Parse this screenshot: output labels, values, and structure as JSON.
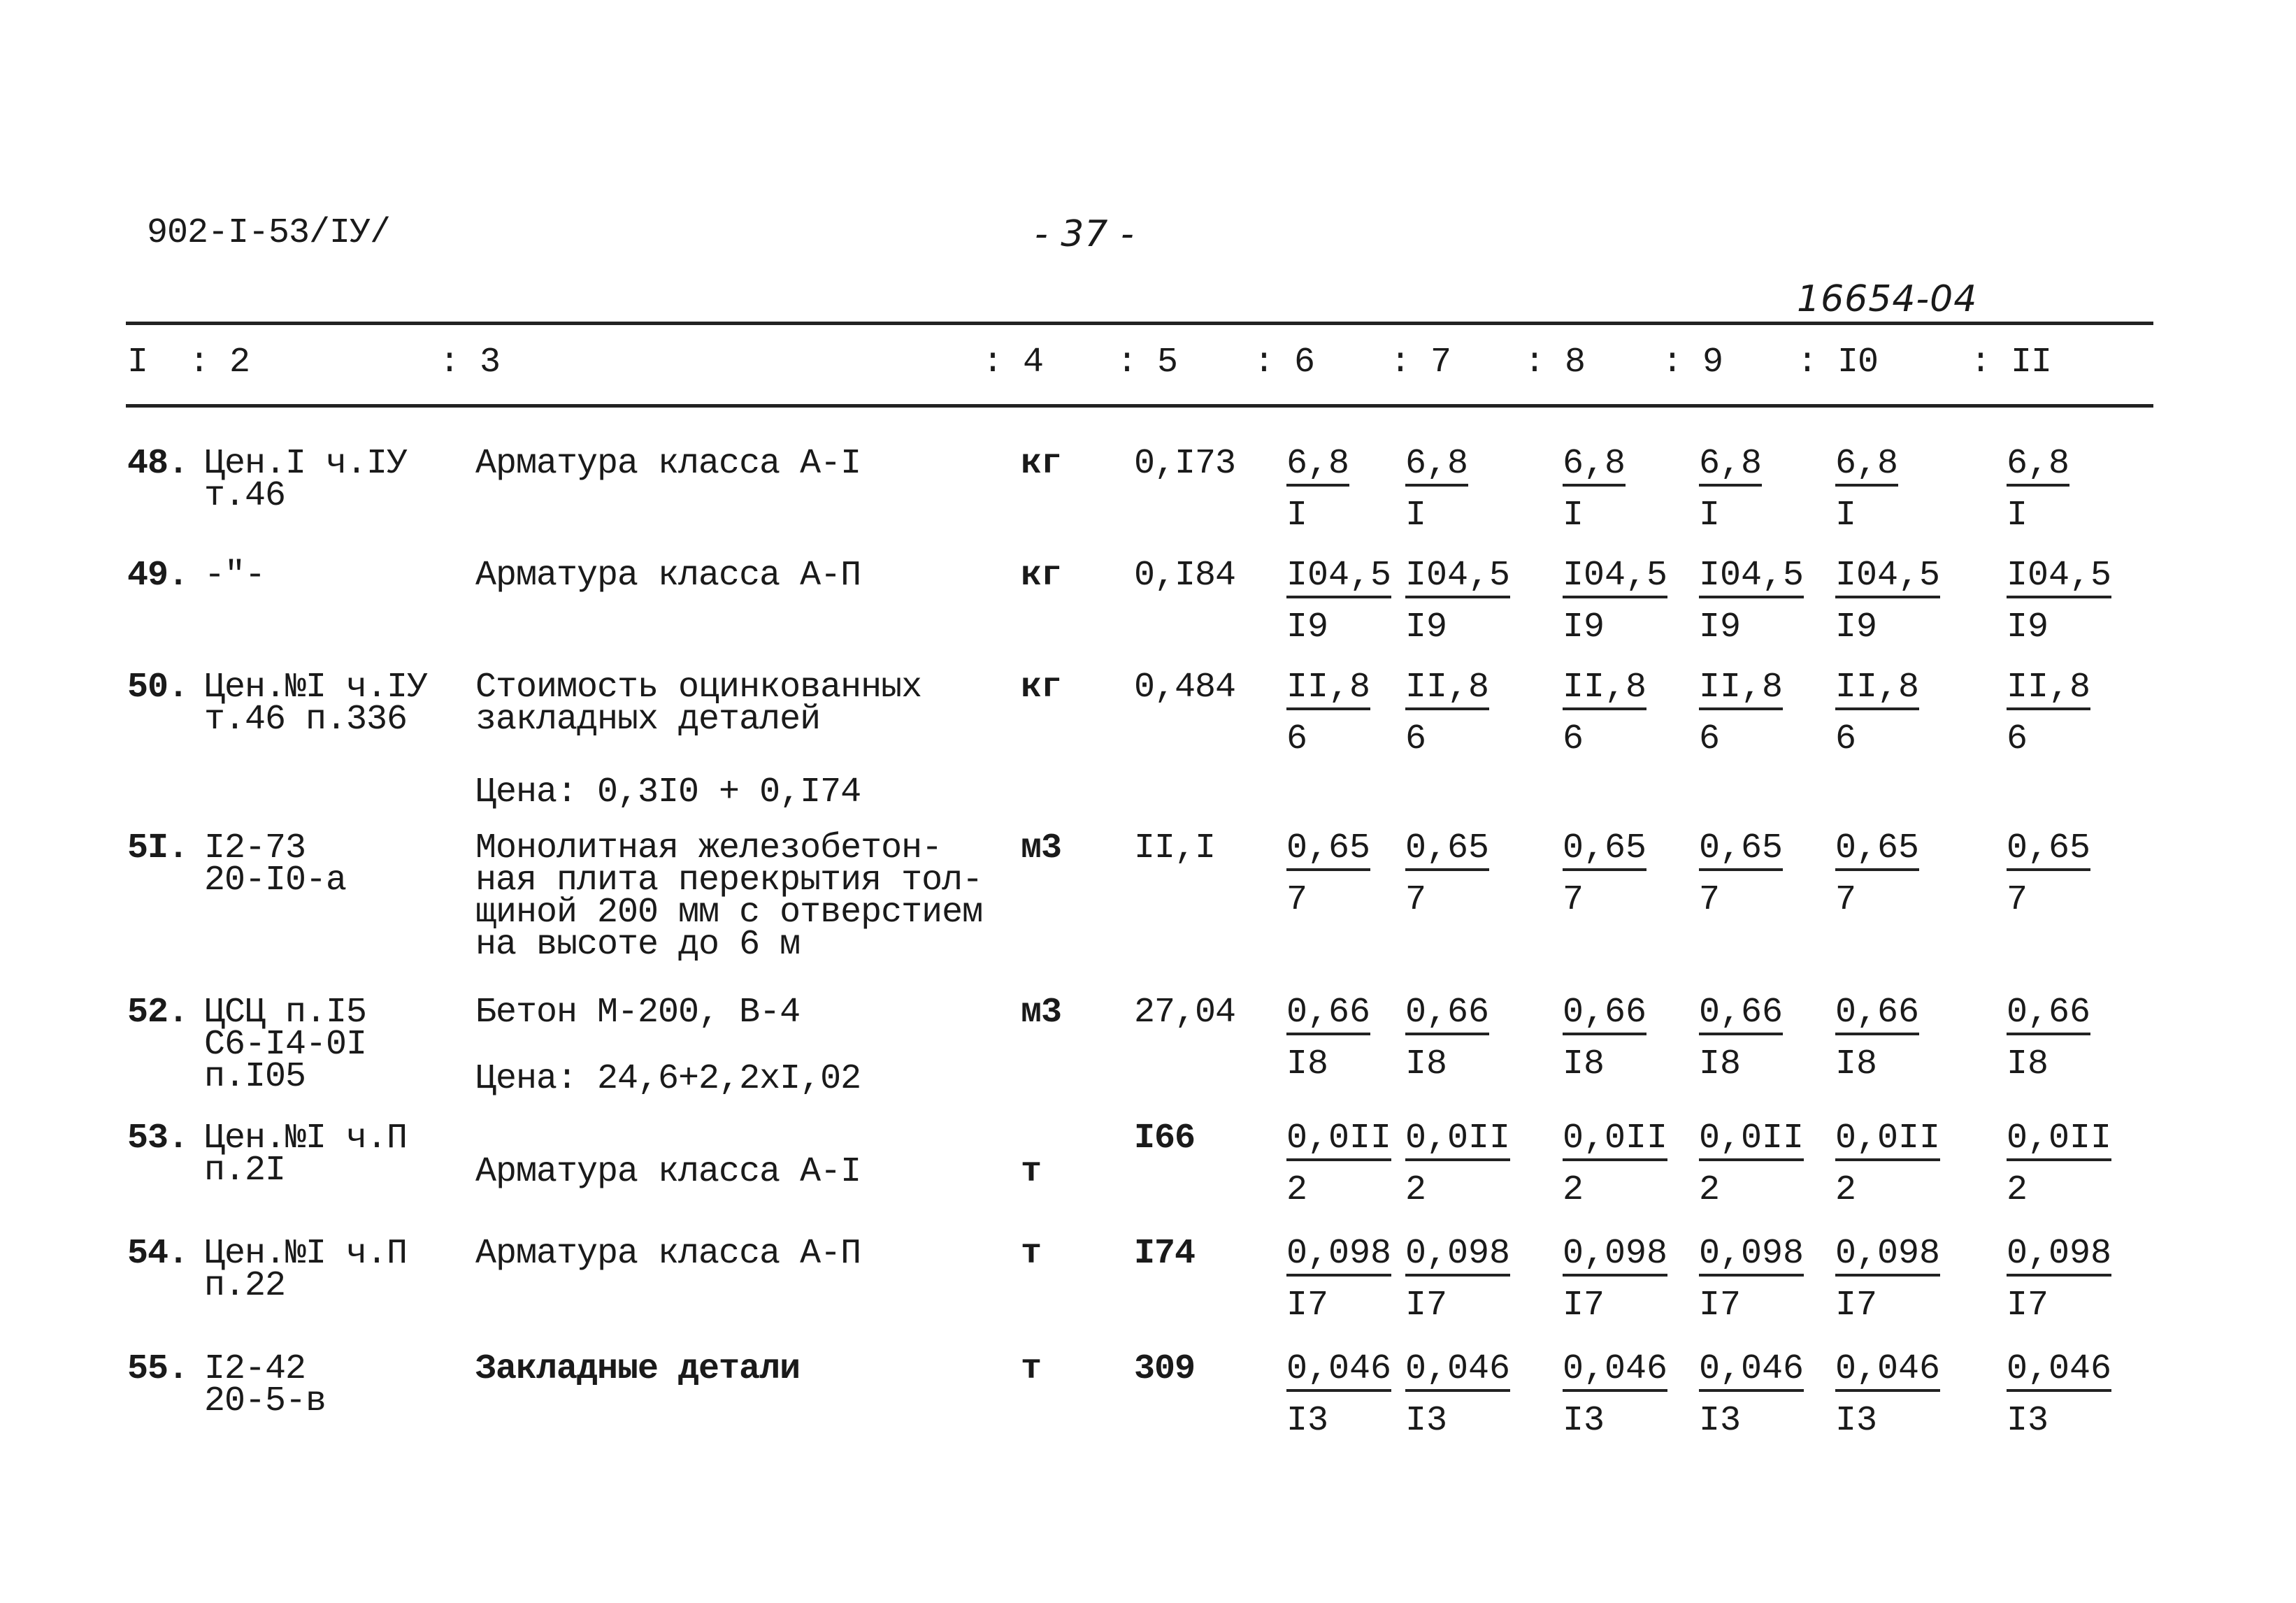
{
  "header": {
    "doc_code": "902-I-53/IУ/",
    "page_number": "- 37 -",
    "inventory_number": "16654-04"
  },
  "columns": [
    "I",
    ": 2",
    ": 3",
    ": 4",
    ": 5",
    ": 6",
    ": 7",
    ": 8",
    ": 9",
    ": I0",
    ": II"
  ],
  "rows": [
    {
      "no": "48.",
      "ref": [
        "Цен.I ч.IУ",
        "т.46"
      ],
      "desc": [
        "Арматура класса А-I"
      ],
      "unit": "кг",
      "price": "0,I73",
      "cells": [
        {
          "num": "6,8",
          "den": "I"
        },
        {
          "num": "6,8",
          "den": "I"
        },
        {
          "num": "6,8",
          "den": "I"
        },
        {
          "num": "6,8",
          "den": "I"
        },
        {
          "num": "6,8",
          "den": "I"
        },
        {
          "num": "6,8",
          "den": "I"
        }
      ]
    },
    {
      "no": "49.",
      "ref": [
        "-\"-"
      ],
      "desc": [
        "Арматура класса А-П"
      ],
      "unit": "кг",
      "price": "0,I84",
      "cells": [
        {
          "num": "I04,5",
          "den": "I9"
        },
        {
          "num": "I04,5",
          "den": "I9"
        },
        {
          "num": "I04,5",
          "den": "I9"
        },
        {
          "num": "I04,5",
          "den": "I9"
        },
        {
          "num": "I04,5",
          "den": "I9"
        },
        {
          "num": "I04,5",
          "den": "I9"
        }
      ]
    },
    {
      "no": "50.",
      "ref": [
        "Цен.№I ч.IУ",
        "т.46 п.336"
      ],
      "desc": [
        "Стоимость оцинкованных",
        "закладных деталей"
      ],
      "note": "Цена: 0,3I0 + 0,I74",
      "unit": "кг",
      "price": "0,484",
      "cells": [
        {
          "num": "II,8",
          "den": "6"
        },
        {
          "num": "II,8",
          "den": "6"
        },
        {
          "num": "II,8",
          "den": "6"
        },
        {
          "num": "II,8",
          "den": "6"
        },
        {
          "num": "II,8",
          "den": "6"
        },
        {
          "num": "II,8",
          "den": "6"
        }
      ]
    },
    {
      "no": "5I.",
      "ref": [
        "I2-73",
        "20-I0-а"
      ],
      "desc": [
        "Монолитная железобетон-",
        "ная плита перекрытия тол-",
        "щиной 200 мм с отверстием",
        "на высоте до 6 м"
      ],
      "unit": "м3",
      "price": "II,I",
      "cells": [
        {
          "num": "0,65",
          "den": "7"
        },
        {
          "num": "0,65",
          "den": "7"
        },
        {
          "num": "0,65",
          "den": "7"
        },
        {
          "num": "0,65",
          "den": "7"
        },
        {
          "num": "0,65",
          "den": "7"
        },
        {
          "num": "0,65",
          "den": "7"
        }
      ]
    },
    {
      "no": "52.",
      "ref": [
        "ЦСЦ п.I5",
        "С6-I4-0I",
        "п.I05"
      ],
      "desc": [
        "Бетон М-200, В-4"
      ],
      "note": "Цена: 24,6+2,2хI,02",
      "unit": "м3",
      "price": "27,04",
      "cells": [
        {
          "num": "0,66",
          "den": "I8"
        },
        {
          "num": "0,66",
          "den": "I8"
        },
        {
          "num": "0,66",
          "den": "I8"
        },
        {
          "num": "0,66",
          "den": "I8"
        },
        {
          "num": "0,66",
          "den": "I8"
        },
        {
          "num": "0,66",
          "den": "I8"
        }
      ]
    },
    {
      "no": "53.",
      "ref": [
        "Цен.№I ч.П",
        "п.2I"
      ],
      "desc": [
        "Арматура класса А-I"
      ],
      "unit": "т",
      "price": "I66",
      "cells": [
        {
          "num": "0,0II",
          "den": "2"
        },
        {
          "num": "0,0II",
          "den": "2"
        },
        {
          "num": "0,0II",
          "den": "2"
        },
        {
          "num": "0,0II",
          "den": "2"
        },
        {
          "num": "0,0II",
          "den": "2"
        },
        {
          "num": "0,0II",
          "den": "2"
        }
      ]
    },
    {
      "no": "54.",
      "ref": [
        "Цен.№I ч.П",
        "п.22"
      ],
      "desc": [
        "Арматура класса А-П"
      ],
      "unit": "т",
      "price": "I74",
      "cells": [
        {
          "num": "0,098",
          "den": "I7"
        },
        {
          "num": "0,098",
          "den": "I7"
        },
        {
          "num": "0,098",
          "den": "I7"
        },
        {
          "num": "0,098",
          "den": "I7"
        },
        {
          "num": "0,098",
          "den": "I7"
        },
        {
          "num": "0,098",
          "den": "I7"
        }
      ]
    },
    {
      "no": "55.",
      "ref": [
        "I2-42",
        "20-5-в"
      ],
      "desc": [
        "Закладные детали"
      ],
      "unit": "т",
      "price": "309",
      "cells": [
        {
          "num": "0,046",
          "den": "I3"
        },
        {
          "num": "0,046",
          "den": "I3"
        },
        {
          "num": "0,046",
          "den": "I3"
        },
        {
          "num": "0,046",
          "den": "I3"
        },
        {
          "num": "0,046",
          "den": "I3"
        },
        {
          "num": "0,046",
          "den": "I3"
        }
      ]
    }
  ]
}
